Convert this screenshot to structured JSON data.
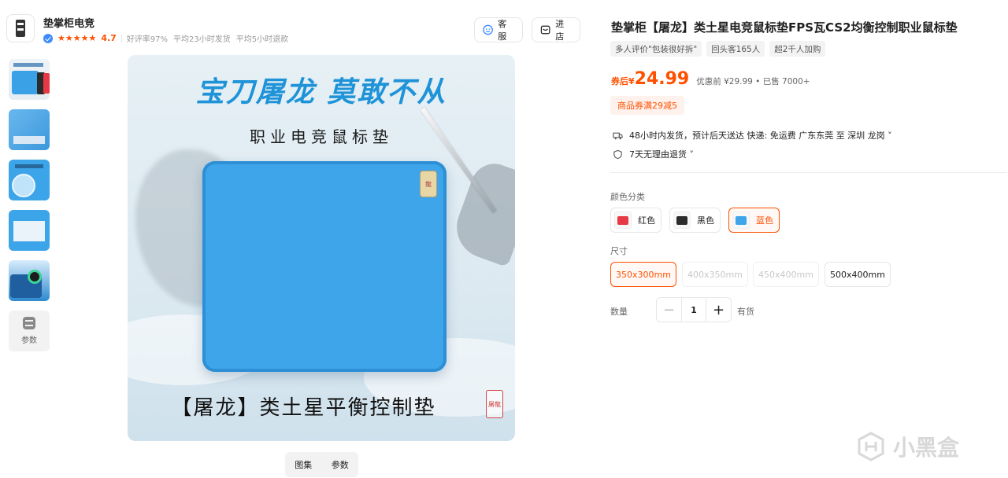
{
  "shop": {
    "name": "垫掌柜电竞",
    "stars": "★★★★★",
    "rating": "4.7",
    "meta": [
      "好评率97%",
      "平均23小时发货",
      "平均5小时退款"
    ],
    "service_label": "客服",
    "enter_shop_label": "进店"
  },
  "gallery": {
    "thumbnails": [
      "thumb-1",
      "thumb-2",
      "thumb-3",
      "thumb-4",
      "thumb-5"
    ],
    "params_label": "参数",
    "slogan": "宝刀屠龙 莫敢不从",
    "subtitle": "职业电竞鼠标垫",
    "bottom_title": "【屠龙】类土星平衡控制垫",
    "tabs": [
      "图集",
      "参数"
    ]
  },
  "product": {
    "title": "垫掌柜【屠龙】类土星电竞鼠标垫FPS瓦CS2均衡控制职业鼠标垫",
    "tags": [
      "多人评价\"包装很好拆\"",
      "回头客165人",
      "超2千人加购"
    ],
    "price_prefix": "券后¥",
    "price": "24.99",
    "price_info": "优惠前 ¥29.99 • 已售 7000+",
    "coupon": "商品券满29减5",
    "shipping": "48小时内发货，预计后天送达  快递: 免运费  广东东莞 至 深圳 龙岗 ˅",
    "returns": "7天无理由退货 ˅",
    "color_label": "颜色分类",
    "colors": [
      {
        "name": "红色",
        "swatch": "#e63945",
        "selected": false
      },
      {
        "name": "黑色",
        "swatch": "#2b2b2b",
        "selected": false
      },
      {
        "name": "蓝色",
        "swatch": "#3fa5ea",
        "selected": true
      }
    ],
    "size_label": "尺寸",
    "sizes": [
      {
        "name": "350x300mm",
        "state": "selected"
      },
      {
        "name": "400x350mm",
        "state": "disabled"
      },
      {
        "name": "450x400mm",
        "state": "disabled"
      },
      {
        "name": "500x400mm",
        "state": "normal"
      }
    ],
    "qty_label": "数量",
    "qty_minus": "−",
    "qty_value": "1",
    "qty_plus": "+",
    "stock": "有货"
  },
  "watermark": "小黑盒",
  "colors": {
    "accent": "#ff5000",
    "pad_blue": "#3fa5ea",
    "slogan_blue": "#1f93d8"
  }
}
